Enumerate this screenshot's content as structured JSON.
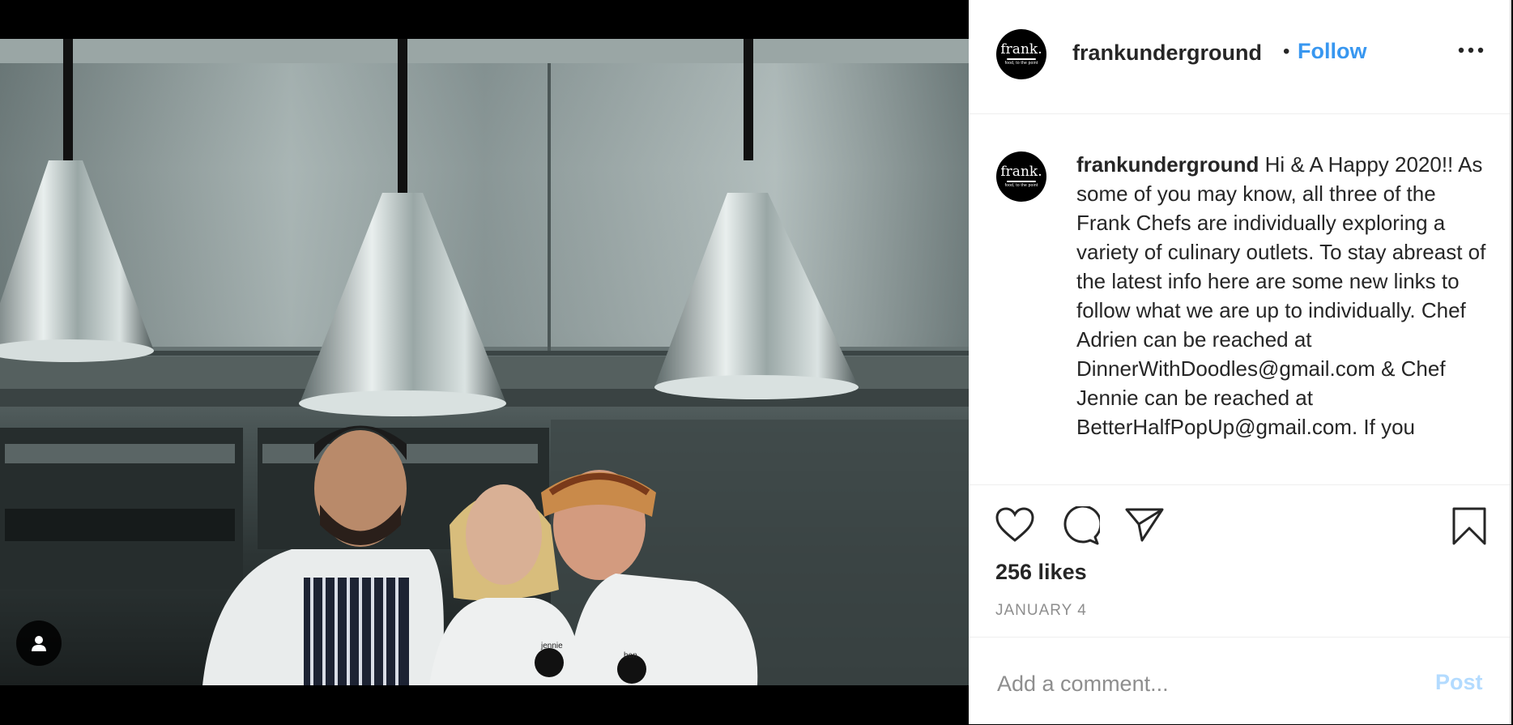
{
  "post": {
    "username": "frankunderground",
    "follow_label": "Follow",
    "separator": "•",
    "avatar": {
      "brand": "frank.",
      "tagline": "food, to the point"
    },
    "more_icon": "more-horizontal-icon"
  },
  "caption": {
    "username": "frankunderground",
    "text": "Hi & A Happy 2020!! As some of you may know, all three of the Frank Chefs are individually exploring a variety of culinary outlets. To stay abreast of the latest info here are some new links to follow what we are up to individually. Chef Adrien can be reached at DinnerWithDoodles@gmail.com & Chef Jennie can be reached at BetterHalfPopUp@gmail.com. If you"
  },
  "photo": {
    "apron_labels": [
      "jennie",
      "ben"
    ],
    "badge_brand": "frank."
  },
  "actions": {
    "likes": "256 likes",
    "date": "JANUARY 4",
    "icons": [
      "heart-icon",
      "comment-icon",
      "share-icon",
      "bookmark-icon"
    ]
  },
  "comment": {
    "placeholder": "Add a comment...",
    "post_label": "Post"
  },
  "colors": {
    "accent": "#3897f0",
    "post_disabled": "#b3dbff",
    "text": "#262626",
    "muted": "#8e8e8e"
  }
}
